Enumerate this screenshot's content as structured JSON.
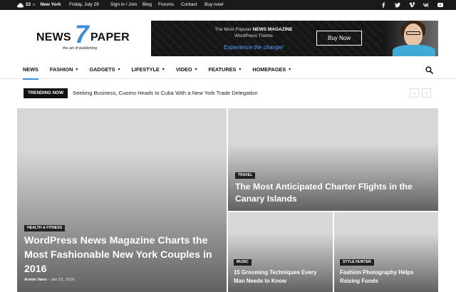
{
  "topbar": {
    "temperature": "22",
    "temperature_unit": "C",
    "city": "New York",
    "date": "Friday, July 29",
    "links": [
      "Sign in / Join",
      "Blog",
      "Forums",
      "Contact",
      "Buy now!"
    ],
    "social_icons": [
      "facebook-icon",
      "twitter-icon",
      "vimeo-icon",
      "vk-icon",
      "youtube-icon"
    ]
  },
  "logo": {
    "news": "NEWS",
    "seven": "7",
    "paper": "PAPER",
    "tagline": "the art of publishing"
  },
  "banner": {
    "line1_prefix": "The Most Popular ",
    "line1_bold": "NEWS MAGAZINE",
    "line2": "WordPress Theme",
    "line3": "Experience the change!",
    "button": "Buy Now"
  },
  "nav": {
    "items": [
      {
        "label": "NEWS",
        "dropdown": false
      },
      {
        "label": "FASHION",
        "dropdown": true
      },
      {
        "label": "GADGETS",
        "dropdown": true
      },
      {
        "label": "LIFESTYLE",
        "dropdown": true
      },
      {
        "label": "VIDEO",
        "dropdown": true
      },
      {
        "label": "FEATURES",
        "dropdown": true
      },
      {
        "label": "HOMEPAGES",
        "dropdown": true
      }
    ],
    "chevron": "▾"
  },
  "trending": {
    "label": "TRENDING NOW",
    "headline": "Seeking Business, Cuomo Heads to Cuba With a New York Trade Delegation",
    "prev": "‹",
    "next": "›"
  },
  "grid": {
    "main": {
      "category": "HEALTH & FITNESS",
      "title": "WordPress News Magazine Charts the Most Fashionable New York Couples in 2016",
      "author": "Armin Vans",
      "separator": " - ",
      "date": "Jan 22, 2016"
    },
    "travel": {
      "category": "TRAVEL",
      "title": "The Most Anticipated Charter Flights in the Canary Islands"
    },
    "music": {
      "category": "MUSIC",
      "title": "15 Grooming Techniques Every Man Needs to Know"
    },
    "style": {
      "category": "STYLE HUNTER",
      "title": "Fashion Photography Helps Raising Funds"
    }
  },
  "colors": {
    "accent": "#3b8dd8",
    "topbar": "#1a1a1a"
  }
}
